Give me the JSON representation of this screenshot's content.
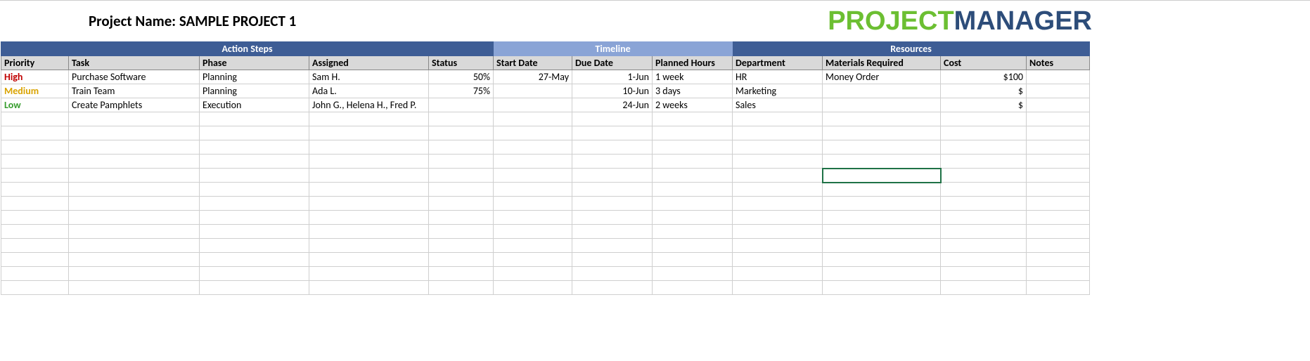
{
  "title": "Project Name: SAMPLE PROJECT 1",
  "logo": {
    "part1": "PROJECT",
    "part2": "MANAGER"
  },
  "groups": {
    "action": "Action Steps",
    "timeline": "Timeline",
    "resources": "Resources"
  },
  "cols": {
    "priority": "Priority",
    "task": "Task",
    "phase": "Phase",
    "assigned": "Assigned",
    "status": "Status",
    "start": "Start Date",
    "due": "Due Date",
    "planned": "Planned Hours",
    "dept": "Department",
    "materials": "Materials Required",
    "cost": "Cost",
    "notes": "Notes"
  },
  "rows": [
    {
      "priority": "High",
      "task": "Purchase Software",
      "phase": "Planning",
      "assigned": "Sam H.",
      "status": "50%",
      "start": "27-May",
      "due": "1-Jun",
      "planned": "1 week",
      "dept": "HR",
      "materials": "Money Order",
      "cost": "$100",
      "notes": ""
    },
    {
      "priority": "Medium",
      "task": "Train Team",
      "phase": "Planning",
      "assigned": "Ada L.",
      "status": "75%",
      "start": "",
      "due": "10-Jun",
      "planned": "3 days",
      "dept": "Marketing",
      "materials": "",
      "cost": "$",
      "notes": ""
    },
    {
      "priority": "Low",
      "task": "Create Pamphlets",
      "phase": "Execution",
      "assigned": "John G., Helena H., Fred P.",
      "status": "",
      "start": "",
      "due": "24-Jun",
      "planned": "2 weeks",
      "dept": "Sales",
      "materials": "",
      "cost": "$",
      "notes": ""
    }
  ]
}
